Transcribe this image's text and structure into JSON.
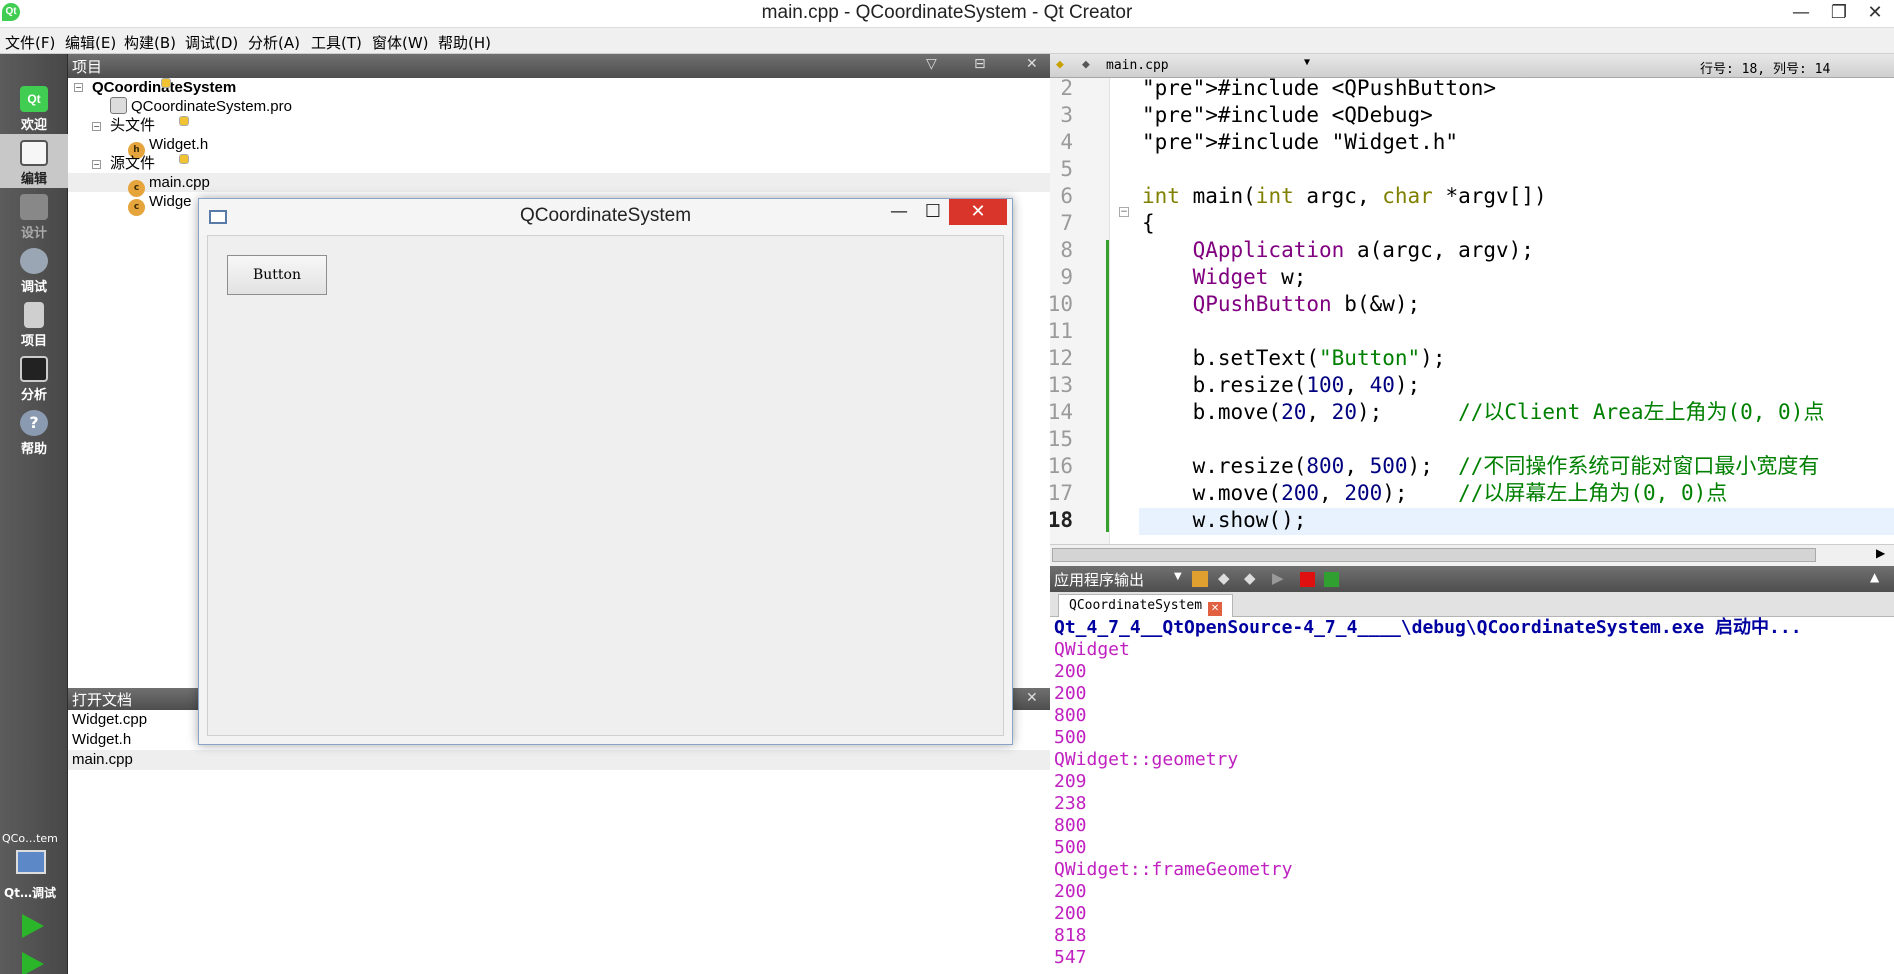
{
  "window": {
    "title": "main.cpp - QCoordinateSystem - Qt Creator",
    "app_icon": "Qt",
    "minimize": "—",
    "maximize": "❐",
    "close": "✕"
  },
  "menu": [
    "文件(F)",
    "编辑(E)",
    "构建(B)",
    "调试(D)",
    "分析(A)",
    "工具(T)",
    "窗体(W)",
    "帮助(H)"
  ],
  "modes": [
    {
      "label": "欢迎",
      "icon": "qt-logo-icon"
    },
    {
      "label": "编辑",
      "icon": "edit-icon"
    },
    {
      "label": "设计",
      "icon": "design-icon"
    },
    {
      "label": "调试",
      "icon": "debug-icon"
    },
    {
      "label": "项目",
      "icon": "project-icon"
    },
    {
      "label": "分析",
      "icon": "analyze-icon"
    },
    {
      "label": "帮助",
      "icon": "help-icon"
    }
  ],
  "kit": {
    "project": "QCo…tem",
    "config": "Qt…调试"
  },
  "project_panel": {
    "title": "项目"
  },
  "tree": [
    {
      "label": "QCoordinateSystem"
    },
    {
      "label": "QCoordinateSystem.pro"
    },
    {
      "label": "头文件"
    },
    {
      "label": "Widget.h"
    },
    {
      "label": "源文件"
    },
    {
      "label": "main.cpp"
    },
    {
      "label": "Widge"
    }
  ],
  "open_docs": {
    "title": "打开文档",
    "items": [
      "Widget.cpp",
      "Widget.h",
      "main.cpp"
    ]
  },
  "editor": {
    "file": "main.cpp",
    "position": "行号: 18, 列号: 14",
    "line_numbers": [
      "2",
      "3",
      "4",
      "5",
      "6",
      "7",
      "8",
      "9",
      "10",
      "11",
      "12",
      "13",
      "14",
      "15",
      "16",
      "17",
      "18"
    ],
    "lines": [
      "#include <QPushButton>",
      "#include <QDebug>",
      "#include \"Widget.h\"",
      "",
      "int main(int argc, char *argv[])",
      "{",
      "    QApplication a(argc, argv);",
      "    Widget w;",
      "    QPushButton b(&w);",
      "",
      "    b.setText(\"Button\");",
      "    b.resize(100, 40);",
      "    b.move(20, 20);      //以Client Area左上角为(0, 0)点",
      "",
      "    w.resize(800, 500);  //不同操作系统可能对窗口最小宽度有",
      "    w.move(200, 200);    //以屏幕左上角为(0, 0)点",
      "    w.show();"
    ]
  },
  "output_panel": {
    "title": "应用程序输出",
    "tab": "QCoordinateSystem",
    "lines": [
      "Qt_4_7_4__QtOpenSource-4_7_4____\\debug\\QCoordinateSystem.exe 启动中...",
      "QWidget",
      "200",
      "200",
      "800",
      "500",
      "QWidget::geometry",
      "209",
      "238",
      "800",
      "500",
      "QWidget::frameGeometry",
      "200",
      "200",
      "818",
      "547"
    ]
  },
  "popup": {
    "title": "QCoordinateSystem",
    "button": "Button",
    "minimize": "—",
    "maximize": "☐",
    "close": "✕"
  }
}
